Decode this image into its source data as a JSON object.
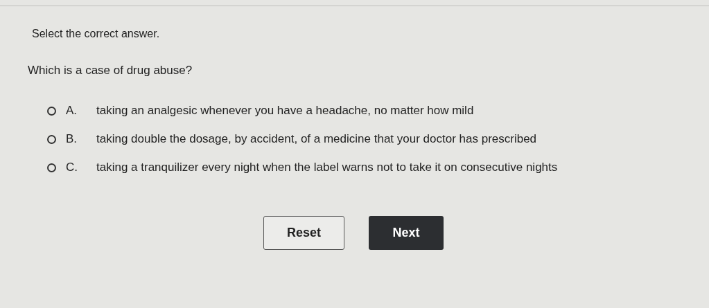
{
  "instruction": "Select the correct answer.",
  "question": "Which is a case of drug abuse?",
  "options": [
    {
      "letter": "A.",
      "text": "taking an analgesic whenever you have a headache, no matter how mild",
      "selected": false
    },
    {
      "letter": "B.",
      "text": "taking double the dosage, by accident, of a medicine that your doctor has prescribed",
      "selected": false
    },
    {
      "letter": "C.",
      "text": "taking a tranquilizer every night when the label warns not to take it on consecutive nights",
      "selected": false
    }
  ],
  "buttons": [
    {
      "kind": "secondary",
      "label": "Reset"
    },
    {
      "kind": "primary",
      "label": "Next"
    }
  ]
}
